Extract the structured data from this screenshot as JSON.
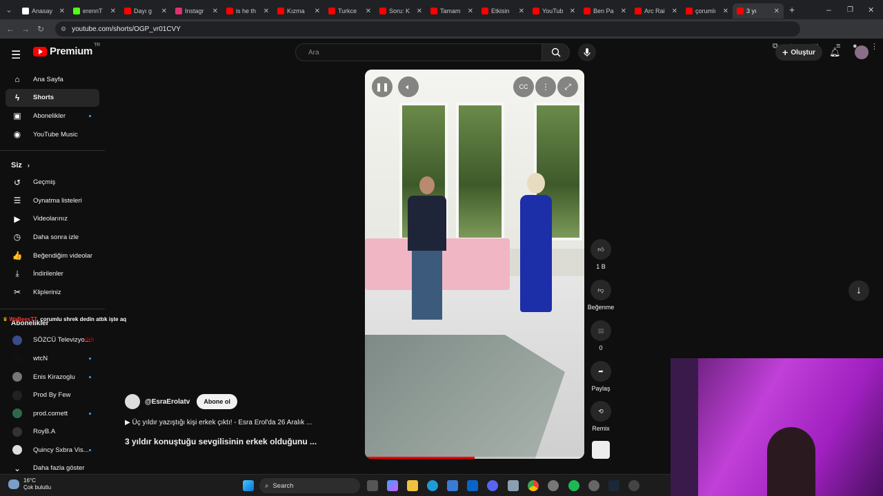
{
  "browser": {
    "tabs": [
      {
        "label": "Anasay",
        "color": "#ffffff"
      },
      {
        "label": "erennT",
        "color": "#53fc18"
      },
      {
        "label": "Dayı g",
        "color": "#ff0000"
      },
      {
        "label": "Instagr",
        "color": "#e1306c"
      },
      {
        "label": "is he th",
        "color": "#ff0000"
      },
      {
        "label": "Kızma",
        "color": "#ff0000"
      },
      {
        "label": "Turkce",
        "color": "#ff0000"
      },
      {
        "label": "Soru: K",
        "color": "#ff0000"
      },
      {
        "label": "Tamam",
        "color": "#ff0000"
      },
      {
        "label": "Etkisin",
        "color": "#ff0000"
      },
      {
        "label": "YouTub",
        "color": "#ff0000"
      },
      {
        "label": "Ben Pa",
        "color": "#ff0000"
      },
      {
        "label": "Arc Rai",
        "color": "#ff0000"
      },
      {
        "label": "çorumlı",
        "color": "#ff0000"
      },
      {
        "label": "3 yı",
        "color": "#ff0000",
        "active": true
      }
    ],
    "url": "youtube.com/shorts/OGP_vr01CVY"
  },
  "header": {
    "logo_text": "Premium",
    "region": "TR",
    "search_placeholder": "Ara",
    "create_label": "Oluştur"
  },
  "sidebar": {
    "main_items": [
      {
        "label": "Ana Sayfa",
        "icon": "home-icon",
        "glyph": "⌂"
      },
      {
        "label": "Shorts",
        "icon": "shorts-icon",
        "glyph": "ϟ",
        "active": true
      },
      {
        "label": "Abonelikler",
        "icon": "subscriptions-icon",
        "glyph": "▣",
        "dot": true
      },
      {
        "label": "YouTube Music",
        "icon": "music-icon",
        "glyph": "◉"
      }
    ],
    "you_label": "Siz",
    "you_items": [
      {
        "label": "Geçmiş",
        "icon": "history-icon",
        "glyph": "↺"
      },
      {
        "label": "Oynatma listeleri",
        "icon": "playlists-icon",
        "glyph": "☰"
      },
      {
        "label": "Videolarınız",
        "icon": "your-videos-icon",
        "glyph": "▶"
      },
      {
        "label": "Daha sonra izle",
        "icon": "watch-later-icon",
        "glyph": "◷"
      },
      {
        "label": "Beğendiğim videolar",
        "icon": "liked-icon",
        "glyph": "👍"
      },
      {
        "label": "İndirilenler",
        "icon": "downloads-icon",
        "glyph": "⤓"
      },
      {
        "label": "Klipleriniz",
        "icon": "clips-icon",
        "glyph": "✂"
      }
    ],
    "subs_label": "Abonelikler",
    "channels": [
      {
        "label": "SÖZCÜ Televizyo...",
        "color": "#3a4a8a",
        "live": true
      },
      {
        "label": "wtcN",
        "color": "#111111",
        "dot": true
      },
      {
        "label": "Enis Kirazoglu",
        "color": "#777777",
        "dot": true
      },
      {
        "label": "Prod By Few",
        "color": "#222222"
      },
      {
        "label": "prod.comett",
        "color": "#2e6a4a",
        "dot": true
      },
      {
        "label": "RoyB.A",
        "color": "#333333"
      },
      {
        "label": "Quincy Sxbra Vis...",
        "color": "#dddddd",
        "dot": true
      }
    ],
    "more_label": "Daha fazla göster"
  },
  "chat_overlay": {
    "user": "WaBeesTT",
    "message": "çorumlu shrek dedin attık işte aq"
  },
  "short": {
    "channel": "@EsraErolatv",
    "subscribe_label": "Abone ol",
    "linked_video": "Üç yıldır yazıştığı kişi erkek çıktı! - Esra Erol'da 26 Aralık ...",
    "title": "3 yıldır konuştuğu sevgilisinin erkek olduğunu ...",
    "progress": 0.5
  },
  "actions": {
    "like_count": "1 B",
    "dislike_label": "Beğenme",
    "comment_count": "0",
    "share_label": "Paylaş",
    "remix_label": "Remix"
  },
  "taskbar": {
    "temp": "16°C",
    "weather": "Çok bulutlu",
    "search_label": "Search",
    "badge": "1"
  }
}
